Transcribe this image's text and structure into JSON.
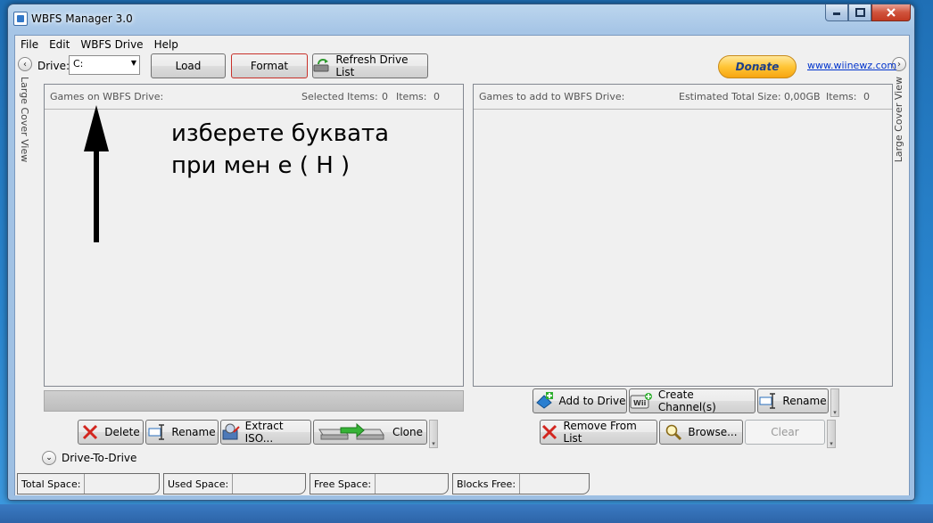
{
  "window": {
    "title": "WBFS Manager 3.0"
  },
  "menu": [
    "File",
    "Edit",
    "WBFS Drive",
    "Help"
  ],
  "side": {
    "left_label": "Large Cover View",
    "right_label": "Large Cover View"
  },
  "toolbar": {
    "drive_label": "Drive:",
    "drive_value": "C:",
    "load": "Load",
    "format": "Format",
    "refresh": "Refresh Drive List",
    "donate": "Donate",
    "link": "www.wiinewz.com"
  },
  "left_panel": {
    "title": "Games on WBFS Drive:",
    "selected_label": "Selected Items:",
    "selected_value": "0",
    "items_label": "Items:",
    "items_value": "0"
  },
  "right_panel": {
    "title": "Games to add to WBFS Drive:",
    "size_label": "Estimated Total Size:",
    "size_value": "0,00GB",
    "items_label": "Items:",
    "items_value": "0"
  },
  "annotation": {
    "line1": "изберете буквата",
    "line2": "при мен е ( H )"
  },
  "left_actions": {
    "delete": "Delete",
    "rename": "Rename",
    "extract": "Extract ISO...",
    "clone": "Clone"
  },
  "right_actions": {
    "add": "Add to Drive",
    "create": "Create Channel(s)",
    "rename": "Rename",
    "remove": "Remove From List",
    "browse": "Browse...",
    "clear": "Clear"
  },
  "drive_to_drive": "Drive-To-Drive",
  "status": {
    "total": "Total Space:",
    "used": "Used Space:",
    "free": "Free Space:",
    "blocks": "Blocks Free:"
  },
  "colors": {
    "accent_blue": "#3278c8",
    "delete_red": "#d3261f",
    "donate_gold": "#ffc536"
  }
}
